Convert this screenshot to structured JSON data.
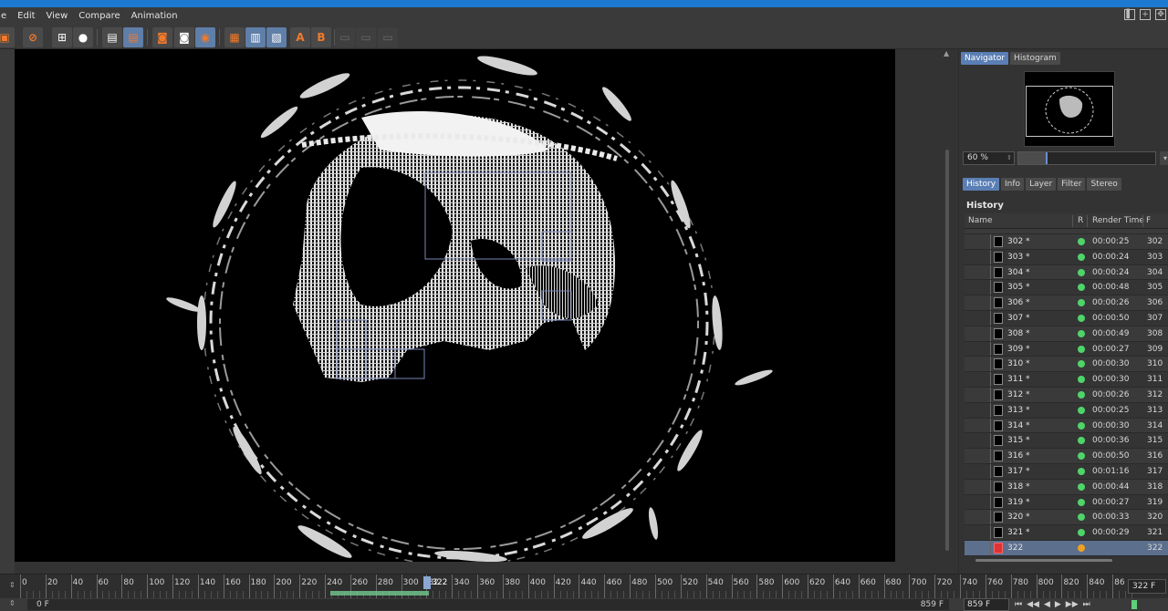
{
  "menu": {
    "items": [
      "Edit",
      "View",
      "Compare",
      "Animation"
    ]
  },
  "toolbar": {
    "icons": [
      "open-icon",
      "stop-render-icon",
      "region-render-icon",
      "user-area-icon",
      "layer-icon",
      "active-layer-icon",
      "show-a-icon",
      "show-b-icon",
      "toggle-ab-icon",
      "compare-icon",
      "wipe-horizontal-icon",
      "wipe-vertical-icon",
      "set-a-icon",
      "set-b-icon",
      "swap-ab-icon",
      "fit-icon",
      "zoom-icon"
    ],
    "set_a_label": "A",
    "set_b_label": "B"
  },
  "panel": {
    "top_tabs": [
      {
        "label": "Navigator",
        "active": true
      },
      {
        "label": "Histogram",
        "active": false
      }
    ],
    "zoom": {
      "value": "60 %",
      "fraction": 0.2
    },
    "bottom_tabs": [
      {
        "label": "History",
        "active": true
      },
      {
        "label": "Info",
        "active": false
      },
      {
        "label": "Layer",
        "active": false
      },
      {
        "label": "Filter",
        "active": false
      },
      {
        "label": "Stereo",
        "active": false
      }
    ],
    "history_title": "History",
    "columns": {
      "name": "Name",
      "r": "R",
      "render_time": "Render Time",
      "f": "F"
    },
    "rows": [
      {
        "name": "302 *",
        "status": "green",
        "time": "00:00:25",
        "frame": "302"
      },
      {
        "name": "303 *",
        "status": "green",
        "time": "00:00:24",
        "frame": "303"
      },
      {
        "name": "304 *",
        "status": "green",
        "time": "00:00:24",
        "frame": "304"
      },
      {
        "name": "305 *",
        "status": "green",
        "time": "00:00:48",
        "frame": "305"
      },
      {
        "name": "306 *",
        "status": "green",
        "time": "00:00:26",
        "frame": "306"
      },
      {
        "name": "307 *",
        "status": "green",
        "time": "00:00:50",
        "frame": "307"
      },
      {
        "name": "308 *",
        "status": "green",
        "time": "00:00:49",
        "frame": "308"
      },
      {
        "name": "309 *",
        "status": "green",
        "time": "00:00:27",
        "frame": "309"
      },
      {
        "name": "310 *",
        "status": "green",
        "time": "00:00:30",
        "frame": "310"
      },
      {
        "name": "311 *",
        "status": "green",
        "time": "00:00:30",
        "frame": "311"
      },
      {
        "name": "312 *",
        "status": "green",
        "time": "00:00:26",
        "frame": "312"
      },
      {
        "name": "313 *",
        "status": "green",
        "time": "00:00:25",
        "frame": "313"
      },
      {
        "name": "314 *",
        "status": "green",
        "time": "00:00:30",
        "frame": "314"
      },
      {
        "name": "315 *",
        "status": "green",
        "time": "00:00:36",
        "frame": "315"
      },
      {
        "name": "316 *",
        "status": "green",
        "time": "00:00:50",
        "frame": "316"
      },
      {
        "name": "317 *",
        "status": "green",
        "time": "00:01:16",
        "frame": "317"
      },
      {
        "name": "318 *",
        "status": "green",
        "time": "00:00:44",
        "frame": "318"
      },
      {
        "name": "319 *",
        "status": "green",
        "time": "00:00:27",
        "frame": "319"
      },
      {
        "name": "320 *",
        "status": "green",
        "time": "00:00:33",
        "frame": "320"
      },
      {
        "name": "321 *",
        "status": "green",
        "time": "00:00:29",
        "frame": "321"
      },
      {
        "name": "322",
        "status": "orange",
        "time": "",
        "frame": "322",
        "selected": true
      }
    ],
    "status_colors": {
      "green": "#4fd46a",
      "orange": "#f0a020"
    }
  },
  "timeline": {
    "ticks": [
      "0",
      "20",
      "40",
      "60",
      "80",
      "100",
      "120",
      "140",
      "160",
      "180",
      "200",
      "220",
      "240",
      "260",
      "280",
      "300",
      "32",
      "340",
      "360",
      "380",
      "400",
      "420",
      "440",
      "460",
      "480",
      "500",
      "520",
      "540",
      "560",
      "580",
      "600",
      "620",
      "640",
      "660",
      "680",
      "700",
      "720",
      "740",
      "760",
      "780",
      "800",
      "820",
      "840",
      "86"
    ],
    "current_label": "322",
    "current_frame_field": "322 F",
    "rendered_range_frames": [
      244,
      322
    ]
  },
  "bottom": {
    "start_frame": "0 F",
    "end_frame": "859 F",
    "end_frame_field": "859 F"
  }
}
